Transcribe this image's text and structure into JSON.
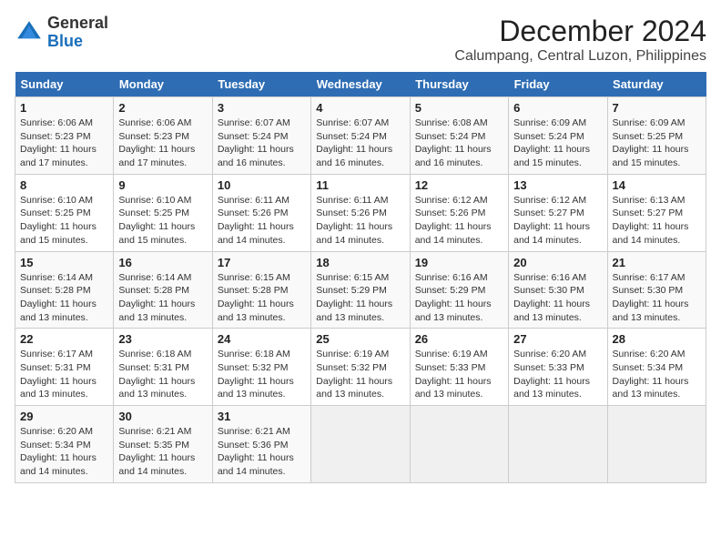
{
  "logo": {
    "general": "General",
    "blue": "Blue"
  },
  "title": "December 2024",
  "subtitle": "Calumpang, Central Luzon, Philippines",
  "weekdays": [
    "Sunday",
    "Monday",
    "Tuesday",
    "Wednesday",
    "Thursday",
    "Friday",
    "Saturday"
  ],
  "weeks": [
    [
      {
        "day": "1",
        "lines": [
          "Sunrise: 6:06 AM",
          "Sunset: 5:23 PM",
          "Daylight: 11 hours",
          "and 17 minutes."
        ]
      },
      {
        "day": "2",
        "lines": [
          "Sunrise: 6:06 AM",
          "Sunset: 5:23 PM",
          "Daylight: 11 hours",
          "and 17 minutes."
        ]
      },
      {
        "day": "3",
        "lines": [
          "Sunrise: 6:07 AM",
          "Sunset: 5:24 PM",
          "Daylight: 11 hours",
          "and 16 minutes."
        ]
      },
      {
        "day": "4",
        "lines": [
          "Sunrise: 6:07 AM",
          "Sunset: 5:24 PM",
          "Daylight: 11 hours",
          "and 16 minutes."
        ]
      },
      {
        "day": "5",
        "lines": [
          "Sunrise: 6:08 AM",
          "Sunset: 5:24 PM",
          "Daylight: 11 hours",
          "and 16 minutes."
        ]
      },
      {
        "day": "6",
        "lines": [
          "Sunrise: 6:09 AM",
          "Sunset: 5:24 PM",
          "Daylight: 11 hours",
          "and 15 minutes."
        ]
      },
      {
        "day": "7",
        "lines": [
          "Sunrise: 6:09 AM",
          "Sunset: 5:25 PM",
          "Daylight: 11 hours",
          "and 15 minutes."
        ]
      }
    ],
    [
      {
        "day": "8",
        "lines": [
          "Sunrise: 6:10 AM",
          "Sunset: 5:25 PM",
          "Daylight: 11 hours",
          "and 15 minutes."
        ]
      },
      {
        "day": "9",
        "lines": [
          "Sunrise: 6:10 AM",
          "Sunset: 5:25 PM",
          "Daylight: 11 hours",
          "and 15 minutes."
        ]
      },
      {
        "day": "10",
        "lines": [
          "Sunrise: 6:11 AM",
          "Sunset: 5:26 PM",
          "Daylight: 11 hours",
          "and 14 minutes."
        ]
      },
      {
        "day": "11",
        "lines": [
          "Sunrise: 6:11 AM",
          "Sunset: 5:26 PM",
          "Daylight: 11 hours",
          "and 14 minutes."
        ]
      },
      {
        "day": "12",
        "lines": [
          "Sunrise: 6:12 AM",
          "Sunset: 5:26 PM",
          "Daylight: 11 hours",
          "and 14 minutes."
        ]
      },
      {
        "day": "13",
        "lines": [
          "Sunrise: 6:12 AM",
          "Sunset: 5:27 PM",
          "Daylight: 11 hours",
          "and 14 minutes."
        ]
      },
      {
        "day": "14",
        "lines": [
          "Sunrise: 6:13 AM",
          "Sunset: 5:27 PM",
          "Daylight: 11 hours",
          "and 14 minutes."
        ]
      }
    ],
    [
      {
        "day": "15",
        "lines": [
          "Sunrise: 6:14 AM",
          "Sunset: 5:28 PM",
          "Daylight: 11 hours",
          "and 13 minutes."
        ]
      },
      {
        "day": "16",
        "lines": [
          "Sunrise: 6:14 AM",
          "Sunset: 5:28 PM",
          "Daylight: 11 hours",
          "and 13 minutes."
        ]
      },
      {
        "day": "17",
        "lines": [
          "Sunrise: 6:15 AM",
          "Sunset: 5:28 PM",
          "Daylight: 11 hours",
          "and 13 minutes."
        ]
      },
      {
        "day": "18",
        "lines": [
          "Sunrise: 6:15 AM",
          "Sunset: 5:29 PM",
          "Daylight: 11 hours",
          "and 13 minutes."
        ]
      },
      {
        "day": "19",
        "lines": [
          "Sunrise: 6:16 AM",
          "Sunset: 5:29 PM",
          "Daylight: 11 hours",
          "and 13 minutes."
        ]
      },
      {
        "day": "20",
        "lines": [
          "Sunrise: 6:16 AM",
          "Sunset: 5:30 PM",
          "Daylight: 11 hours",
          "and 13 minutes."
        ]
      },
      {
        "day": "21",
        "lines": [
          "Sunrise: 6:17 AM",
          "Sunset: 5:30 PM",
          "Daylight: 11 hours",
          "and 13 minutes."
        ]
      }
    ],
    [
      {
        "day": "22",
        "lines": [
          "Sunrise: 6:17 AM",
          "Sunset: 5:31 PM",
          "Daylight: 11 hours",
          "and 13 minutes."
        ]
      },
      {
        "day": "23",
        "lines": [
          "Sunrise: 6:18 AM",
          "Sunset: 5:31 PM",
          "Daylight: 11 hours",
          "and 13 minutes."
        ]
      },
      {
        "day": "24",
        "lines": [
          "Sunrise: 6:18 AM",
          "Sunset: 5:32 PM",
          "Daylight: 11 hours",
          "and 13 minutes."
        ]
      },
      {
        "day": "25",
        "lines": [
          "Sunrise: 6:19 AM",
          "Sunset: 5:32 PM",
          "Daylight: 11 hours",
          "and 13 minutes."
        ]
      },
      {
        "day": "26",
        "lines": [
          "Sunrise: 6:19 AM",
          "Sunset: 5:33 PM",
          "Daylight: 11 hours",
          "and 13 minutes."
        ]
      },
      {
        "day": "27",
        "lines": [
          "Sunrise: 6:20 AM",
          "Sunset: 5:33 PM",
          "Daylight: 11 hours",
          "and 13 minutes."
        ]
      },
      {
        "day": "28",
        "lines": [
          "Sunrise: 6:20 AM",
          "Sunset: 5:34 PM",
          "Daylight: 11 hours",
          "and 13 minutes."
        ]
      }
    ],
    [
      {
        "day": "29",
        "lines": [
          "Sunrise: 6:20 AM",
          "Sunset: 5:34 PM",
          "Daylight: 11 hours",
          "and 14 minutes."
        ]
      },
      {
        "day": "30",
        "lines": [
          "Sunrise: 6:21 AM",
          "Sunset: 5:35 PM",
          "Daylight: 11 hours",
          "and 14 minutes."
        ]
      },
      {
        "day": "31",
        "lines": [
          "Sunrise: 6:21 AM",
          "Sunset: 5:36 PM",
          "Daylight: 11 hours",
          "and 14 minutes."
        ]
      },
      null,
      null,
      null,
      null
    ]
  ]
}
